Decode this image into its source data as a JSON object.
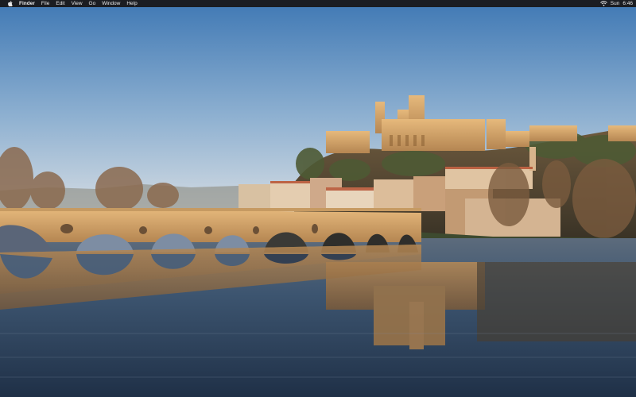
{
  "menubar": {
    "apple_icon": "apple-icon",
    "app_name": "Finder",
    "items": [
      {
        "label": "File"
      },
      {
        "label": "Edit"
      },
      {
        "label": "View"
      },
      {
        "label": "Go"
      },
      {
        "label": "Window"
      },
      {
        "label": "Help"
      }
    ],
    "status": {
      "wifi_icon": "wifi-icon",
      "day": "Sun",
      "time": "6:46"
    }
  },
  "desktop": {
    "wallpaper": "old-bridge-cathedral-river-reflection",
    "colors": {
      "sky_top": "#3f78b4",
      "sky_bottom": "#c8d3de",
      "stone": "#d9a86b",
      "water": "#2a3d55"
    }
  }
}
